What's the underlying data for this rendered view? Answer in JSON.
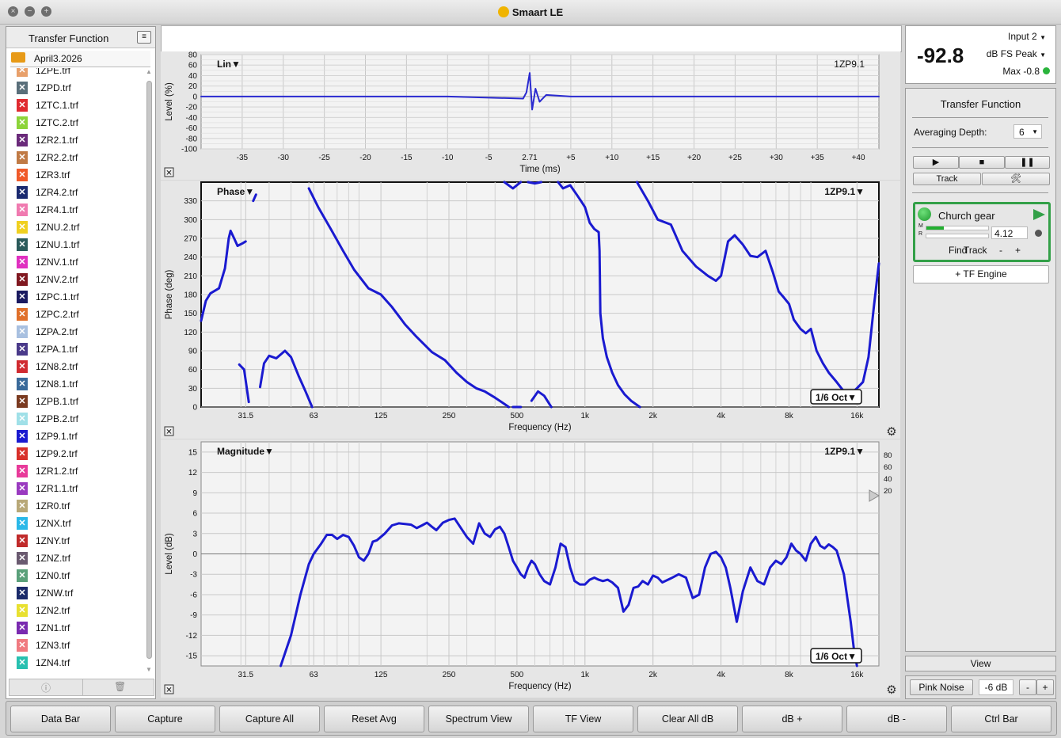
{
  "window": {
    "title": "Smaart LE"
  },
  "left_panel": {
    "title": "Transfer Function",
    "folder": "April3.2026",
    "files": [
      {
        "name": "1ZPE.trf",
        "color": "#e8a06a"
      },
      {
        "name": "1ZPD.trf",
        "color": "#5a6f7a"
      },
      {
        "name": "1ZTC.1.trf",
        "color": "#e02a30"
      },
      {
        "name": "1ZTC.2.trf",
        "color": "#8cd43a"
      },
      {
        "name": "1ZR2.1.trf",
        "color": "#6a2a7a"
      },
      {
        "name": "1ZR2.2.trf",
        "color": "#c07a45"
      },
      {
        "name": "1ZR3.trf",
        "color": "#f05a2a"
      },
      {
        "name": "1ZR4.2.trf",
        "color": "#1a2a70"
      },
      {
        "name": "1ZR4.1.trf",
        "color": "#f07ab0"
      },
      {
        "name": "1ZNU.2.trf",
        "color": "#f0d020"
      },
      {
        "name": "1ZNU.1.trf",
        "color": "#2a5a5a"
      },
      {
        "name": "1ZNV.1.trf",
        "color": "#e030c0"
      },
      {
        "name": "1ZNV.2.trf",
        "color": "#801820"
      },
      {
        "name": "1ZPC.1.trf",
        "color": "#1a1a60"
      },
      {
        "name": "1ZPC.2.trf",
        "color": "#e0702a"
      },
      {
        "name": "1ZPA.2.trf",
        "color": "#a8c0e0"
      },
      {
        "name": "1ZPA.1.trf",
        "color": "#4a3a8a"
      },
      {
        "name": "1ZN8.2.trf",
        "color": "#d02a30"
      },
      {
        "name": "1ZN8.1.trf",
        "color": "#3a6a9a"
      },
      {
        "name": "1ZPB.1.trf",
        "color": "#7a3a20"
      },
      {
        "name": "1ZPB.2.trf",
        "color": "#a0e0e8"
      },
      {
        "name": "1ZP9.1.trf",
        "color": "#1a1ad0"
      },
      {
        "name": "1ZP9.2.trf",
        "color": "#d8302a"
      },
      {
        "name": "1ZR1.2.trf",
        "color": "#e83a9a"
      },
      {
        "name": "1ZR1.1.trf",
        "color": "#9a3ac0"
      },
      {
        "name": "1ZR0.trf",
        "color": "#b8a878"
      },
      {
        "name": "1ZNX.trf",
        "color": "#2ab8e8"
      },
      {
        "name": "1ZNY.trf",
        "color": "#c02a2a"
      },
      {
        "name": "1ZNZ.trf",
        "color": "#6a5a70"
      },
      {
        "name": "1ZN0.trf",
        "color": "#5aa07a"
      },
      {
        "name": "1ZNW.trf",
        "color": "#1a2a6a"
      },
      {
        "name": "1ZN2.trf",
        "color": "#e8e030"
      },
      {
        "name": "1ZN1.trf",
        "color": "#7a2ab0"
      },
      {
        "name": "1ZN3.trf",
        "color": "#f07a80"
      },
      {
        "name": "1ZN4.trf",
        "color": "#28c0b0"
      }
    ],
    "footer_icons": [
      "info-icon",
      "trash-icon"
    ]
  },
  "meter": {
    "value": "-92.8",
    "input": "Input 2",
    "unit": "dB FS Peak",
    "max": "Max -0.8"
  },
  "right_panel": {
    "title": "Transfer Function",
    "averaging_label": "Averaging Depth:",
    "averaging_value": "6",
    "track_label": "Track",
    "engine": {
      "name": "Church gear",
      "delay": "4.12",
      "find": "Find",
      "track": "Track",
      "minus": "-",
      "plus": "+",
      "meter_m": "M",
      "meter_r": "R"
    },
    "tf_engine_label": "+ TF Engine",
    "view_label": "View",
    "pink_noise": "Pink Noise",
    "pink_level": "-6 dB",
    "pink_minus": "-",
    "pink_plus": "+"
  },
  "bottom_buttons": [
    "Data Bar",
    "Capture",
    "Capture All",
    "Reset Avg",
    "Spectrum View",
    "TF View",
    "Clear All dB",
    "dB +",
    "dB -",
    "Ctrl Bar"
  ],
  "chart_data": [
    {
      "type": "line",
      "title": "Lin",
      "trace": "1ZP9.1",
      "xlabel": "Time (ms)",
      "ylabel": "Level (%)",
      "xlim": [
        -40,
        42.5
      ],
      "ylim": [
        -100,
        80
      ],
      "x_ticks": [
        "-35",
        "-30",
        "-25",
        "-20",
        "-15",
        "-10",
        "-5",
        "2.71",
        "+5",
        "+10",
        "+15",
        "+20",
        "+25",
        "+30",
        "+35",
        "+40"
      ],
      "x_tick_values": [
        -35,
        -30,
        -25,
        -20,
        -15,
        -10,
        -5,
        0,
        5,
        10,
        15,
        20,
        25,
        30,
        35,
        40
      ],
      "y_ticks": [
        80,
        60,
        40,
        20,
        0,
        -20,
        -40,
        -60,
        -80,
        -100
      ],
      "series": [
        {
          "color": "#2a2ad0",
          "x": [
            -40,
            -10,
            -0.8,
            -0.4,
            0,
            0.3,
            0.7,
            1.2,
            2,
            5,
            42.5
          ],
          "y": [
            0,
            0,
            -4,
            8,
            45,
            -25,
            15,
            -10,
            3,
            0,
            0
          ]
        }
      ]
    },
    {
      "type": "line",
      "title": "Phase",
      "trace": "1ZP9.1",
      "smoothing": "1/6 Oct",
      "xlabel": "Frequency (Hz)",
      "ylabel": "Phase (deg)",
      "xscale": "log",
      "xlim": [
        20,
        20000
      ],
      "ylim": [
        0,
        360
      ],
      "x_ticks": [
        "31.5",
        "63",
        "125",
        "250",
        "500",
        "1k",
        "2k",
        "4k",
        "8k",
        "16k"
      ],
      "x_tick_values": [
        31.5,
        63,
        125,
        250,
        500,
        1000,
        2000,
        4000,
        8000,
        16000
      ],
      "y_ticks": [
        0,
        30,
        60,
        90,
        120,
        150,
        180,
        210,
        240,
        270,
        300,
        330
      ],
      "series": [
        {
          "color": "#1a1ad0",
          "segments": [
            [
              [
                20,
                138
              ],
              [
                21,
                170
              ],
              [
                22,
                182
              ],
              [
                24,
                190
              ],
              [
                25.5,
                222
              ],
              [
                26.5,
                270
              ],
              [
                27,
                282
              ],
              [
                28,
                270
              ],
              [
                29,
                258
              ],
              [
                30.5,
                262
              ],
              [
                31.5,
                265
              ]
            ],
            [
              [
                34,
                330
              ],
              [
                35,
                340
              ]
            ],
            [
              [
                29.5,
                68
              ],
              [
                31,
                60
              ],
              [
                32.5,
                8
              ]
            ],
            [
              [
                36.5,
                32
              ],
              [
                38,
                70
              ],
              [
                40,
                82
              ],
              [
                43,
                78
              ],
              [
                47,
                90
              ],
              [
                50,
                80
              ],
              [
                54,
                50
              ],
              [
                58,
                25
              ],
              [
                62,
                0
              ]
            ],
            [
              [
                60,
                350
              ],
              [
                66,
                320
              ],
              [
                75,
                285
              ],
              [
                85,
                250
              ],
              [
                95,
                220
              ],
              [
                110,
                190
              ],
              [
                125,
                180
              ],
              [
                140,
                160
              ],
              [
                160,
                132
              ],
              [
                180,
                112
              ],
              [
                210,
                88
              ],
              [
                240,
                75
              ],
              [
                270,
                55
              ],
              [
                300,
                40
              ],
              [
                330,
                30
              ],
              [
                360,
                25
              ],
              [
                400,
                15
              ],
              [
                440,
                5
              ],
              [
                460,
                0
              ]
            ],
            [
              [
                480,
                0
              ],
              [
                520,
                0
              ]
            ],
            [
              [
                580,
                10
              ],
              [
                620,
                25
              ],
              [
                660,
                18
              ],
              [
                710,
                0
              ]
            ],
            [
              [
                440,
                360
              ],
              [
                480,
                350
              ],
              [
                520,
                360
              ]
            ],
            [
              [
                560,
                360
              ],
              [
                600,
                358
              ],
              [
                640,
                360
              ]
            ],
            [
              [
                760,
                360
              ],
              [
                800,
                350
              ],
              [
                860,
                355
              ],
              [
                920,
                340
              ],
              [
                960,
                330
              ],
              [
                1000,
                320
              ],
              [
                1050,
                295
              ],
              [
                1100,
                285
              ],
              [
                1150,
                280
              ],
              [
                1160,
                250
              ],
              [
                1170,
                150
              ],
              [
                1200,
                110
              ],
              [
                1250,
                80
              ],
              [
                1320,
                55
              ],
              [
                1400,
                35
              ],
              [
                1500,
                20
              ],
              [
                1600,
                10
              ],
              [
                1750,
                0
              ]
            ],
            [
              [
                1700,
                360
              ],
              [
                1900,
                330
              ],
              [
                2100,
                300
              ],
              [
                2400,
                292
              ],
              [
                2700,
                250
              ],
              [
                3100,
                225
              ],
              [
                3500,
                210
              ],
              [
                3800,
                202
              ],
              [
                4000,
                210
              ],
              [
                4300,
                265
              ],
              [
                4600,
                275
              ],
              [
                5000,
                260
              ],
              [
                5400,
                242
              ],
              [
                5800,
                240
              ],
              [
                6300,
                250
              ],
              [
                6800,
                215
              ],
              [
                7200,
                185
              ],
              [
                7600,
                175
              ],
              [
                8000,
                165
              ],
              [
                8400,
                140
              ],
              [
                9000,
                125
              ],
              [
                9500,
                118
              ],
              [
                10000,
                125
              ],
              [
                10600,
                90
              ],
              [
                11300,
                70
              ],
              [
                12000,
                55
              ],
              [
                13000,
                40
              ],
              [
                14000,
                25
              ],
              [
                15000,
                20
              ],
              [
                16000,
                30
              ],
              [
                17000,
                40
              ],
              [
                18000,
                80
              ],
              [
                19000,
                160
              ],
              [
                20000,
                230
              ]
            ]
          ]
        }
      ]
    },
    {
      "type": "line",
      "title": "Magnitude",
      "trace": "1ZP9.1",
      "smoothing": "1/6 Oct",
      "xlabel": "Frequency (Hz)",
      "ylabel": "Level (dB)",
      "xscale": "log",
      "xlim": [
        20,
        20000
      ],
      "ylim": [
        -16.5,
        16.5
      ],
      "x_ticks": [
        "31.5",
        "63",
        "125",
        "250",
        "500",
        "1k",
        "2k",
        "4k",
        "8k",
        "16k"
      ],
      "x_tick_values": [
        31.5,
        63,
        125,
        250,
        500,
        1000,
        2000,
        4000,
        8000,
        16000
      ],
      "y_ticks": [
        15,
        12,
        9,
        6,
        3,
        0,
        -3,
        -6,
        -9,
        -12,
        -15
      ],
      "coherence_ticks": [
        "80",
        "60",
        "40",
        "20"
      ],
      "series": [
        {
          "color": "#1a1ad0",
          "x": [
            45,
            50,
            55,
            60,
            63,
            68,
            72,
            76,
            80,
            85,
            90,
            95,
            100,
            105,
            110,
            115,
            120,
            130,
            140,
            150,
            160,
            170,
            180,
            190,
            200,
            210,
            220,
            235,
            250,
            265,
            280,
            300,
            320,
            340,
            360,
            380,
            400,
            420,
            440,
            460,
            480,
            500,
            520,
            540,
            560,
            580,
            600,
            630,
            660,
            700,
            740,
            780,
            820,
            860,
            900,
            950,
            1000,
            1050,
            1100,
            1150,
            1200,
            1260,
            1320,
            1400,
            1480,
            1560,
            1640,
            1720,
            1800,
            1900,
            2000,
            2100,
            2200,
            2400,
            2600,
            2800,
            3000,
            3200,
            3400,
            3600,
            3800,
            4000,
            4200,
            4400,
            4700,
            5000,
            5400,
            5800,
            6200,
            6600,
            7000,
            7400,
            7800,
            8200,
            8600,
            9000,
            9500,
            10000,
            10500,
            11000,
            11500,
            12000,
            12500,
            13000,
            14000,
            15000,
            15500,
            16000
          ],
          "y": [
            -16.5,
            -12,
            -6,
            -1.5,
            0,
            1.5,
            2.8,
            2.8,
            2.2,
            2.8,
            2.5,
            1.2,
            -0.5,
            -1,
            0,
            1.8,
            2,
            3,
            4.2,
            4.5,
            4.4,
            4.3,
            3.8,
            4.2,
            4.6,
            4,
            3.5,
            4.6,
            5,
            5.2,
            4,
            2.5,
            1.5,
            4.5,
            3,
            2.5,
            3.6,
            4,
            3,
            1,
            -1,
            -2,
            -3,
            -3.5,
            -2,
            -1,
            -1.5,
            -3,
            -4,
            -4.5,
            -2,
            1.5,
            1,
            -2,
            -4,
            -4.5,
            -4.5,
            -3.8,
            -3.5,
            -3.8,
            -4,
            -3.8,
            -4.2,
            -5,
            -8.5,
            -7.5,
            -5,
            -4.8,
            -4,
            -4.5,
            -3.2,
            -3.5,
            -4.2,
            -3.6,
            -3,
            -3.5,
            -6.5,
            -6,
            -2,
            0,
            0.3,
            -0.5,
            -2,
            -5,
            -10,
            -5.5,
            -2,
            -4,
            -4.5,
            -2,
            -1,
            -1.5,
            -0.5,
            1.5,
            0.5,
            0,
            -1,
            1.5,
            2.5,
            1.2,
            0.8,
            1.4,
            1,
            0.5,
            -3,
            -10,
            -14,
            -16.5
          ]
        }
      ]
    }
  ]
}
